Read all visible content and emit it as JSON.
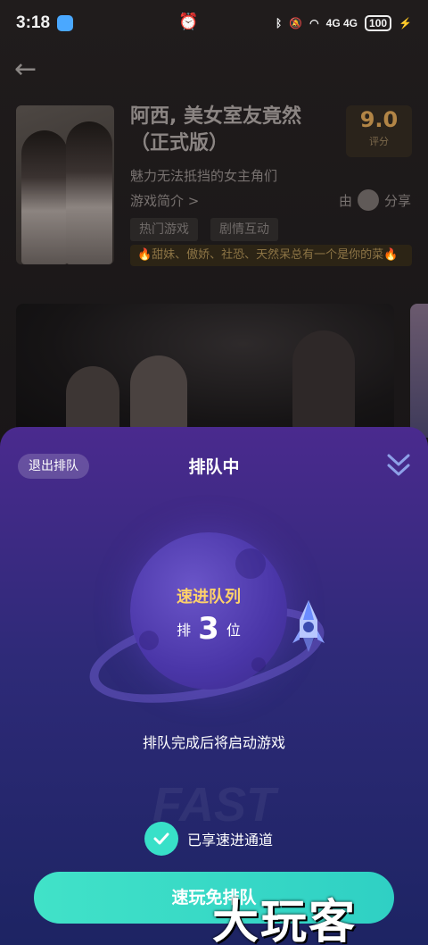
{
  "status_bar": {
    "time": "3:18",
    "network": "4G 4G",
    "battery": "100"
  },
  "game": {
    "title": "阿西, 美女室友竟然（正式版）",
    "score": "9.0",
    "score_label": "评分",
    "subtitle": "魅力无法抵挡的女主角们",
    "intro_link": "游戏简介 >",
    "share_prefix": "由",
    "share_label": "分享",
    "tags": [
      "热门游戏",
      "剧情互动"
    ],
    "promo": "🔥甜妹、傲娇、社恐、天然呆总有一个是你的菜🔥"
  },
  "queue": {
    "exit_label": "退出排队",
    "title": "排队中",
    "planet_title": "速进队列",
    "position_prefix": "排",
    "position": "3",
    "position_suffix": "位",
    "message": "排队完成后将启动游戏",
    "fast_text": "FAST",
    "check_label": "已享速进通道",
    "button_label": "速玩免排队"
  },
  "watermark": "大玩客",
  "colors": {
    "accent_teal": "#38e0c8",
    "gold": "#ffd26a",
    "sheet_top": "#4a2a8e",
    "sheet_bottom": "#1d2463"
  }
}
